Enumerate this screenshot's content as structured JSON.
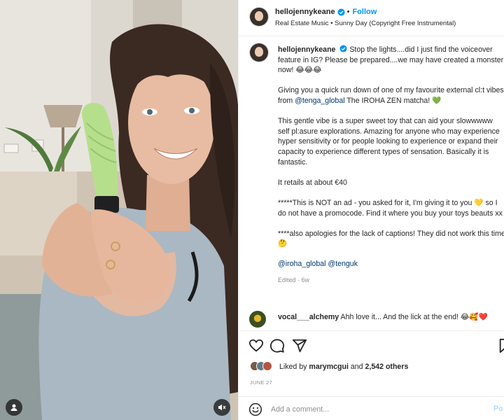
{
  "post": {
    "username": "hellojennykeane",
    "follow_label": "Follow",
    "audio": "Real Estate Music • Sunny Day (Copyright Free Instrumental)"
  },
  "caption": {
    "username": "hellojennykeane",
    "p1": "Stop the lights....did I just find the voiceover feature in IG? Please be prepared....we may have created a monster now! 😂😂😂",
    "p2_a": "Giving you a quick run down of one of my favourite external cl:t vibes from ",
    "p2_mention": "@tenga_global",
    "p2_b": " The IROHA ZEN matcha! 💚",
    "p3": "This gentle vibe is a super sweet toy that can aid your slowwwww self pl:asure explorations. Amazing for anyone who may experience hyper sensitivity or for people looking to experience or expand their capacity to experience different types of sensation. Basically it is fantastic.",
    "p4": "It retails at about €40",
    "p5": "*****This is NOT an ad - you asked for it, I'm giving it to you 💛 so I do not have a promocode. Find it where you buy your toys beauts xx",
    "p6": "****also apologies for the lack of captions! They did not work this time 🤔",
    "tags": "@iroha_global @tenguk",
    "edited": "Edited · 6w"
  },
  "comment": {
    "username": "vocal___alchemy",
    "text": "Ahh love it... And the lick at the end! 😂🥰❤️"
  },
  "likes": {
    "prefix": "Liked by ",
    "user": "marymcgui",
    "mid": " and ",
    "count": "2,542 others"
  },
  "date": "JUNE 27",
  "add_comment": {
    "placeholder": "Add a comment...",
    "post_label": "Po"
  },
  "icons": {
    "verified": "verified-badge-icon",
    "like": "heart-icon",
    "comment": "comment-bubble-icon",
    "share": "paper-plane-icon",
    "save": "bookmark-icon",
    "emoji": "smiley-icon",
    "tagged": "user-tag-icon",
    "mute": "muted-speaker-icon"
  },
  "colors": {
    "link_blue": "#0095f6",
    "mention": "#00376b",
    "muted_text": "#8e8e8e"
  }
}
